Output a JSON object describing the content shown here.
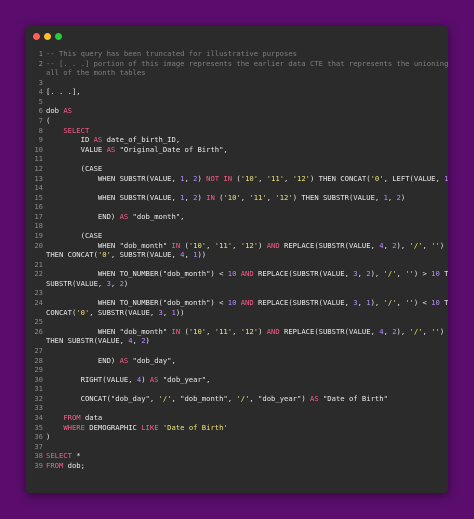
{
  "colors": {
    "background": "#5b0d6e",
    "editor": "#2b2b2b",
    "comment": "#7f7f7f",
    "keyword": "#ff5c8a",
    "string": "#f0e47a",
    "number": "#b58cff",
    "plain": "#ececec",
    "line_number": "#8a8a8a"
  },
  "window_buttons": [
    "close-dot",
    "minimize-dot",
    "maximize-dot"
  ],
  "lines": [
    {
      "n": "1",
      "t": [
        [
          "cm",
          "-- This query has been truncated for illustrative purposes"
        ]
      ]
    },
    {
      "n": "2",
      "t": [
        [
          "cm",
          "-- [. . .] portion of this image represents the earlier data CTE that represents the unioning of"
        ]
      ]
    },
    {
      "n": "",
      "t": [
        [
          "cm",
          "all of the month tables"
        ]
      ]
    },
    {
      "n": "3",
      "t": []
    },
    {
      "n": "4",
      "t": [
        [
          "pl",
          "[. . .],"
        ]
      ]
    },
    {
      "n": "5",
      "t": []
    },
    {
      "n": "6",
      "t": [
        [
          "pl",
          "dob "
        ],
        [
          "kw",
          "AS"
        ]
      ]
    },
    {
      "n": "7",
      "t": [
        [
          "pl",
          "("
        ]
      ]
    },
    {
      "n": "8",
      "t": [
        [
          "pl",
          "    "
        ],
        [
          "kw",
          "SELECT"
        ]
      ]
    },
    {
      "n": "9",
      "t": [
        [
          "pl",
          "        ID "
        ],
        [
          "kw",
          "AS"
        ],
        [
          "pl",
          " date_of_birth_ID,"
        ]
      ]
    },
    {
      "n": "10",
      "t": [
        [
          "pl",
          "        VALUE "
        ],
        [
          "kw",
          "AS"
        ],
        [
          "pl",
          " \"Original_Date of Birth\","
        ]
      ]
    },
    {
      "n": "11",
      "t": []
    },
    {
      "n": "12",
      "t": [
        [
          "pl",
          "        (CASE"
        ]
      ]
    },
    {
      "n": "13",
      "t": [
        [
          "pl",
          "            WHEN SUBSTR(VALUE, "
        ],
        [
          "num",
          "1"
        ],
        [
          "pl",
          ", "
        ],
        [
          "num",
          "2"
        ],
        [
          "pl",
          ") "
        ],
        [
          "kw",
          "NOT IN"
        ],
        [
          "pl",
          " ("
        ],
        [
          "str",
          "'10'"
        ],
        [
          "pl",
          ", "
        ],
        [
          "str",
          "'11'"
        ],
        [
          "pl",
          ", "
        ],
        [
          "str",
          "'12'"
        ],
        [
          "pl",
          ") THEN CONCAT("
        ],
        [
          "str",
          "'0'"
        ],
        [
          "pl",
          ", LEFT(VALUE, "
        ],
        [
          "num",
          "1"
        ],
        [
          "pl",
          "))"
        ]
      ]
    },
    {
      "n": "14",
      "t": []
    },
    {
      "n": "15",
      "t": [
        [
          "pl",
          "            WHEN SUBSTR(VALUE, "
        ],
        [
          "num",
          "1"
        ],
        [
          "pl",
          ", "
        ],
        [
          "num",
          "2"
        ],
        [
          "pl",
          ") "
        ],
        [
          "kw",
          "IN"
        ],
        [
          "pl",
          " ("
        ],
        [
          "str",
          "'10'"
        ],
        [
          "pl",
          ", "
        ],
        [
          "str",
          "'11'"
        ],
        [
          "pl",
          ", "
        ],
        [
          "str",
          "'12'"
        ],
        [
          "pl",
          ") THEN SUBSTR(VALUE, "
        ],
        [
          "num",
          "1"
        ],
        [
          "pl",
          ", "
        ],
        [
          "num",
          "2"
        ],
        [
          "pl",
          ")"
        ]
      ]
    },
    {
      "n": "16",
      "t": []
    },
    {
      "n": "17",
      "t": [
        [
          "pl",
          "            END) "
        ],
        [
          "kw",
          "AS"
        ],
        [
          "pl",
          " \"dob_month\","
        ]
      ]
    },
    {
      "n": "18",
      "t": []
    },
    {
      "n": "19",
      "t": [
        [
          "pl",
          "        (CASE"
        ]
      ]
    },
    {
      "n": "20",
      "t": [
        [
          "pl",
          "            WHEN \"dob_month\" "
        ],
        [
          "kw",
          "IN"
        ],
        [
          "pl",
          " ("
        ],
        [
          "str",
          "'10'"
        ],
        [
          "pl",
          ", "
        ],
        [
          "str",
          "'11'"
        ],
        [
          "pl",
          ", "
        ],
        [
          "str",
          "'12'"
        ],
        [
          "pl",
          ") "
        ],
        [
          "kw",
          "AND"
        ],
        [
          "pl",
          " REPLACE(SUBSTR(VALUE, "
        ],
        [
          "num",
          "4"
        ],
        [
          "pl",
          ", "
        ],
        [
          "num",
          "2"
        ],
        [
          "pl",
          "), "
        ],
        [
          "str",
          "'/'"
        ],
        [
          "pl",
          ", "
        ],
        [
          "str",
          "''"
        ],
        [
          "pl",
          ") < "
        ],
        [
          "num",
          "10"
        ]
      ]
    },
    {
      "n": "",
      "t": [
        [
          "pl",
          "THEN CONCAT("
        ],
        [
          "str",
          "'0'"
        ],
        [
          "pl",
          ", SUBSTR(VALUE, "
        ],
        [
          "num",
          "4"
        ],
        [
          "pl",
          ", "
        ],
        [
          "num",
          "1"
        ],
        [
          "pl",
          "))"
        ]
      ]
    },
    {
      "n": "21",
      "t": []
    },
    {
      "n": "22",
      "t": [
        [
          "pl",
          "            WHEN TO_NUMBER(\"dob_month\") < "
        ],
        [
          "num",
          "10"
        ],
        [
          "pl",
          " "
        ],
        [
          "kw",
          "AND"
        ],
        [
          "pl",
          " REPLACE(SUBSTR(VALUE, "
        ],
        [
          "num",
          "3"
        ],
        [
          "pl",
          ", "
        ],
        [
          "num",
          "2"
        ],
        [
          "pl",
          "), "
        ],
        [
          "str",
          "'/'"
        ],
        [
          "pl",
          ", "
        ],
        [
          "str",
          "''"
        ],
        [
          "pl",
          ") > "
        ],
        [
          "num",
          "10"
        ],
        [
          "pl",
          " THEN"
        ]
      ]
    },
    {
      "n": "",
      "t": [
        [
          "pl",
          "SUBSTR(VALUE, "
        ],
        [
          "num",
          "3"
        ],
        [
          "pl",
          ", "
        ],
        [
          "num",
          "2"
        ],
        [
          "pl",
          ")"
        ]
      ]
    },
    {
      "n": "23",
      "t": []
    },
    {
      "n": "24",
      "t": [
        [
          "pl",
          "            WHEN TO_NUMBER(\"dob_month\") < "
        ],
        [
          "num",
          "10"
        ],
        [
          "pl",
          " "
        ],
        [
          "kw",
          "AND"
        ],
        [
          "pl",
          " REPLACE(SUBSTR(VALUE, "
        ],
        [
          "num",
          "3"
        ],
        [
          "pl",
          ", "
        ],
        [
          "num",
          "1"
        ],
        [
          "pl",
          "), "
        ],
        [
          "str",
          "'/'"
        ],
        [
          "pl",
          ", "
        ],
        [
          "str",
          "''"
        ],
        [
          "pl",
          ") < "
        ],
        [
          "num",
          "10"
        ],
        [
          "pl",
          " THEN"
        ]
      ]
    },
    {
      "n": "",
      "t": [
        [
          "pl",
          "CONCAT("
        ],
        [
          "str",
          "'0'"
        ],
        [
          "pl",
          ", SUBSTR(VALUE, "
        ],
        [
          "num",
          "3"
        ],
        [
          "pl",
          ", "
        ],
        [
          "num",
          "1"
        ],
        [
          "pl",
          "))"
        ]
      ]
    },
    {
      "n": "25",
      "t": []
    },
    {
      "n": "26",
      "t": [
        [
          "pl",
          "            WHEN \"dob_month\" "
        ],
        [
          "kw",
          "IN"
        ],
        [
          "pl",
          " ("
        ],
        [
          "str",
          "'10'"
        ],
        [
          "pl",
          ", "
        ],
        [
          "str",
          "'11'"
        ],
        [
          "pl",
          ", "
        ],
        [
          "str",
          "'12'"
        ],
        [
          "pl",
          ") "
        ],
        [
          "kw",
          "AND"
        ],
        [
          "pl",
          " REPLACE(SUBSTR(VALUE, "
        ],
        [
          "num",
          "4"
        ],
        [
          "pl",
          ", "
        ],
        [
          "num",
          "2"
        ],
        [
          "pl",
          "), "
        ],
        [
          "str",
          "'/'"
        ],
        [
          "pl",
          ", "
        ],
        [
          "str",
          "''"
        ],
        [
          "pl",
          ") ≥ "
        ],
        [
          "num",
          "10"
        ]
      ]
    },
    {
      "n": "",
      "t": [
        [
          "pl",
          "THEN SUBSTR(VALUE, "
        ],
        [
          "num",
          "4"
        ],
        [
          "pl",
          ", "
        ],
        [
          "num",
          "2"
        ],
        [
          "pl",
          ")"
        ]
      ]
    },
    {
      "n": "27",
      "t": []
    },
    {
      "n": "28",
      "t": [
        [
          "pl",
          "            END) "
        ],
        [
          "kw",
          "AS"
        ],
        [
          "pl",
          " \"dob_day\","
        ]
      ]
    },
    {
      "n": "29",
      "t": []
    },
    {
      "n": "30",
      "t": [
        [
          "pl",
          "        RIGHT(VALUE, "
        ],
        [
          "num",
          "4"
        ],
        [
          "pl",
          ") "
        ],
        [
          "kw",
          "AS"
        ],
        [
          "pl",
          " \"dob_year\","
        ]
      ]
    },
    {
      "n": "31",
      "t": []
    },
    {
      "n": "32",
      "t": [
        [
          "pl",
          "        CONCAT(\"dob_day\", "
        ],
        [
          "str",
          "'/'"
        ],
        [
          "pl",
          ", \"dob_month\", "
        ],
        [
          "str",
          "'/'"
        ],
        [
          "pl",
          ", \"dob_year\") "
        ],
        [
          "kw",
          "AS"
        ],
        [
          "pl",
          " \"Date of Birth\""
        ]
      ]
    },
    {
      "n": "33",
      "t": []
    },
    {
      "n": "34",
      "t": [
        [
          "pl",
          "    "
        ],
        [
          "kw",
          "FROM"
        ],
        [
          "pl",
          " data"
        ]
      ]
    },
    {
      "n": "35",
      "t": [
        [
          "pl",
          "    "
        ],
        [
          "kw",
          "WHERE"
        ],
        [
          "pl",
          " DEMOGRAPHIC "
        ],
        [
          "kw",
          "LIKE"
        ],
        [
          "pl",
          " "
        ],
        [
          "str",
          "'Date of Birth'"
        ]
      ]
    },
    {
      "n": "36",
      "t": [
        [
          "pl",
          ")"
        ]
      ]
    },
    {
      "n": "37",
      "t": []
    },
    {
      "n": "38",
      "t": [
        [
          "kw",
          "SELECT"
        ],
        [
          "pl",
          " *"
        ]
      ]
    },
    {
      "n": "39",
      "t": [
        [
          "kw",
          "FROM"
        ],
        [
          "pl",
          " dob;"
        ]
      ]
    }
  ]
}
